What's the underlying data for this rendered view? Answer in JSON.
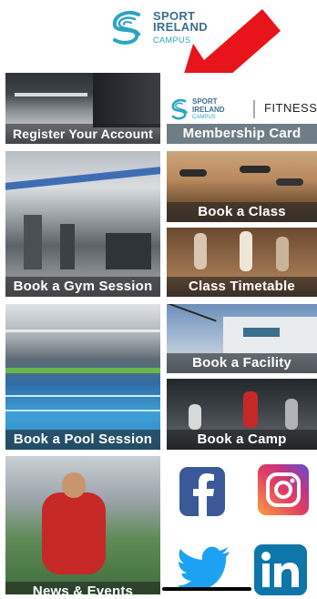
{
  "header": {
    "logo_line1": "SPORT",
    "logo_line2": "IRELAND",
    "logo_line3": "CAMPUS"
  },
  "tiles": {
    "register": "Register Your Account",
    "membership": "Membership Card",
    "membership_brand_sport": "SPORT",
    "membership_brand_ireland": "IRELAND",
    "membership_brand_campus": "CAMPUS",
    "membership_brand_fitness": "FITNESS",
    "book_class": "Book a Class",
    "book_gym": "Book a Gym Session",
    "class_timetable": "Class Timetable",
    "book_facility": "Book a Facility",
    "book_pool": "Book a Pool Session",
    "book_camp": "Book a Camp",
    "news_events": "News & Events"
  },
  "colors": {
    "brand_blue": "#3b6f8c",
    "brand_teal": "#2ba4c0",
    "arrow_red": "#e8141b",
    "facebook": "#3b5998",
    "linkedin": "#0e76a8",
    "twitter": "#1da1f2"
  },
  "social": [
    "facebook-icon",
    "instagram-icon",
    "twitter-icon",
    "linkedin-icon"
  ]
}
